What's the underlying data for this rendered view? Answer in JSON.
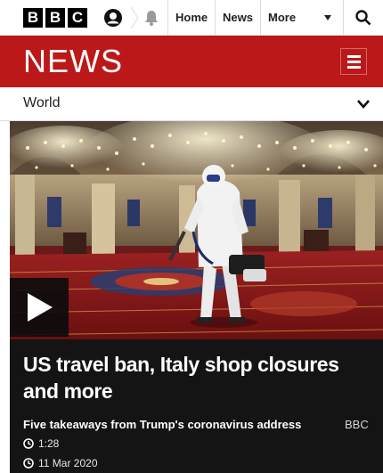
{
  "brand": {
    "letters": [
      "B",
      "B",
      "C"
    ],
    "news_wordmark": "NEWS",
    "accent_color": "#bb1919"
  },
  "topnav": {
    "items": [
      {
        "label": "Home"
      },
      {
        "label": "News"
      },
      {
        "label": "More"
      }
    ],
    "icons": [
      "account-icon",
      "notifications-bell-icon",
      "search-icon"
    ]
  },
  "section": {
    "title": "World",
    "toggle_icon": "chevron-down-icon"
  },
  "media": {
    "play_icon": "play-icon"
  },
  "story": {
    "headline": "US travel ban, Italy shop closures and more",
    "summary": "Five takeaways from Trump's coronavirus address",
    "source": "BBC",
    "duration": "1:28",
    "date": "11 Mar 2020"
  }
}
